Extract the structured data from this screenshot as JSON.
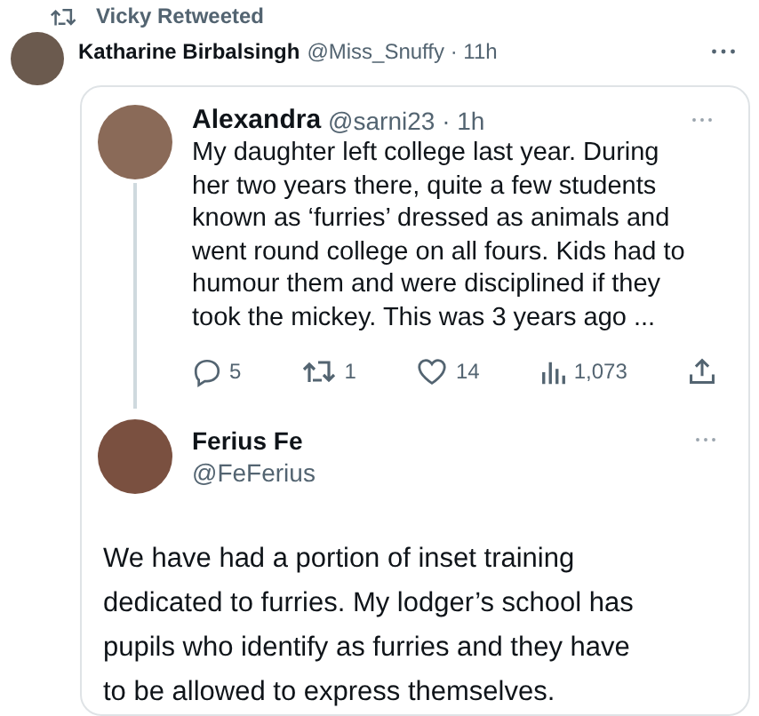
{
  "retweet_banner": {
    "label": "Vicky Retweeted"
  },
  "tweet": {
    "author": "Katharine Birbalsingh",
    "handle": "@Miss_Snuffy",
    "separator": "·",
    "time": "11h"
  },
  "quoted_thread": {
    "first": {
      "author": "Alexandra",
      "handle": "@sarni23",
      "separator": "·",
      "time": "1h",
      "text": "My daughter left college last year. During her two years there, quite a few students known as ‘furries’ dressed as animals and went round college on all fours. Kids had to humour them and were disciplined if they took the mickey. This was 3 years ago ...",
      "actions": [
        {
          "kind": "reply",
          "count": "5"
        },
        {
          "kind": "retweet",
          "count": "1"
        },
        {
          "kind": "like",
          "count": "14"
        },
        {
          "kind": "views",
          "count": "1,073"
        },
        {
          "kind": "share"
        }
      ]
    },
    "reply": {
      "author": "Ferius Fe",
      "handle": "@FeFerius",
      "text": "We have had a portion of inset training dedicated to furries. My lodger’s school has pupils who identify as furries and they have to be allowed to express themselves."
    }
  }
}
